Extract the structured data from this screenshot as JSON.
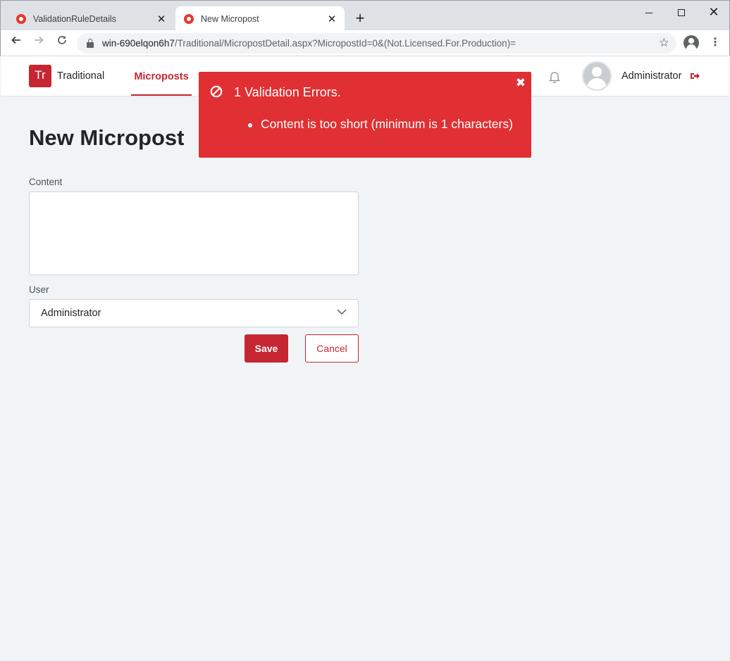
{
  "browser": {
    "tabs": [
      {
        "title": "ValidationRuleDetails",
        "active": false
      },
      {
        "title": "New Micropost",
        "active": true
      }
    ],
    "url_host": "win-690elqon6h7",
    "url_path": "/Traditional/MicropostDetail.aspx?MicropostId=0&(Not.Licensed.For.Production)="
  },
  "header": {
    "logo_text": "Tr",
    "brand": "Traditional",
    "nav_active": "Microposts",
    "user_name": "Administrator"
  },
  "page": {
    "title": "New Micropost",
    "content_label": "Content",
    "user_label": "User",
    "user_selected": "Administrator",
    "save_label": "Save",
    "cancel_label": "Cancel"
  },
  "toast": {
    "title": "1 Validation Errors.",
    "errors": [
      "Content is too short (minimum is 1 characters)"
    ]
  },
  "colors": {
    "accent": "#c62631",
    "error_bg": "#e03033",
    "page_bg": "#f1f4f7"
  }
}
